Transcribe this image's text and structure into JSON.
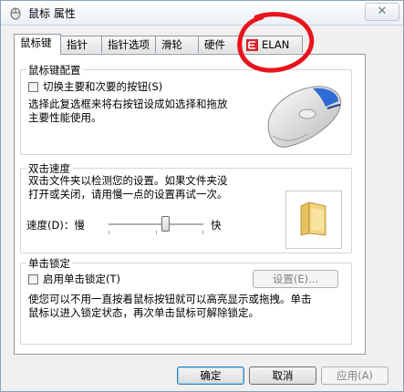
{
  "window": {
    "title": "鼠标 属性",
    "close_glyph": "✕"
  },
  "tabs": [
    {
      "label": "鼠标键"
    },
    {
      "label": "指针"
    },
    {
      "label": "指针选项"
    },
    {
      "label": "滑轮"
    },
    {
      "label": "硬件"
    },
    {
      "label": "ELAN"
    }
  ],
  "button_config": {
    "group_label": "鼠标键配置",
    "checkbox_label": "切换主要和次要的按钮(S)",
    "checkbox_checked": false,
    "description_line1": "选择此复选框来将右按钮设成如选择和拖放",
    "description_line2": "主要性能使用。"
  },
  "double_click": {
    "group_label": "双击速度",
    "description_line1": "双击文件夹以检测您的设置。如果文件夹没",
    "description_line2": "打开或关闭，请用慢一点的设置再试一次。",
    "speed_label": "速度(D)：慢",
    "fast_label": "快",
    "slider_fraction": 0.6
  },
  "click_lock": {
    "group_label": "单击锁定",
    "checkbox_label": "启用单击锁定(T)",
    "checkbox_checked": false,
    "settings_button": "设置(E)...",
    "description_line1": "使您可以不用一直按着鼠标按钮就可以高亮显示或拖拽。单击",
    "description_line2": "鼠标以进入锁定状态，再次单击鼠标可解除锁定。"
  },
  "footer": {
    "ok": "确定",
    "cancel": "取消",
    "apply": "应用(A)"
  },
  "colors": {
    "annotation_red": "#e8141c",
    "folder_yellow": "#f2d27a",
    "mouse_blue": "#2f6bd4"
  }
}
